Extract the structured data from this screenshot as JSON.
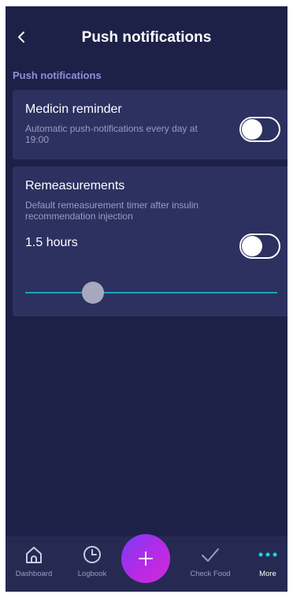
{
  "header": {
    "back_icon": "chevron-left-icon",
    "title": "Push notifications"
  },
  "section": {
    "title": "Push notifications"
  },
  "medicine_reminder": {
    "title": "Medicin reminder",
    "description": "Automatic push-notifications every day at 19:00",
    "toggle_on": false
  },
  "remeasurements": {
    "title": "Remeasurements",
    "description": "Default remeasurement timer after insulin recommendation injection",
    "value": "1.5 hours",
    "toggle_on": false,
    "slider_fraction": 0.27
  },
  "bottom_nav": {
    "items": [
      {
        "label": "Dashboard",
        "icon": "home-icon",
        "active": false
      },
      {
        "label": "Logbook",
        "icon": "clock-icon",
        "active": false
      },
      {
        "label": "Check Food",
        "icon": "checkmark-icon",
        "active": false
      },
      {
        "label": "More",
        "icon": "more-dots-icon",
        "active": true
      }
    ],
    "fab_icon": "plus-icon"
  },
  "colors": {
    "background": "#1d2148",
    "card": "#2c3160",
    "accent_teal": "#1fa4b8",
    "section_title": "#8f8fd6",
    "fab_gradient_start": "#7a3cf3",
    "fab_gradient_end": "#d12bd6"
  }
}
